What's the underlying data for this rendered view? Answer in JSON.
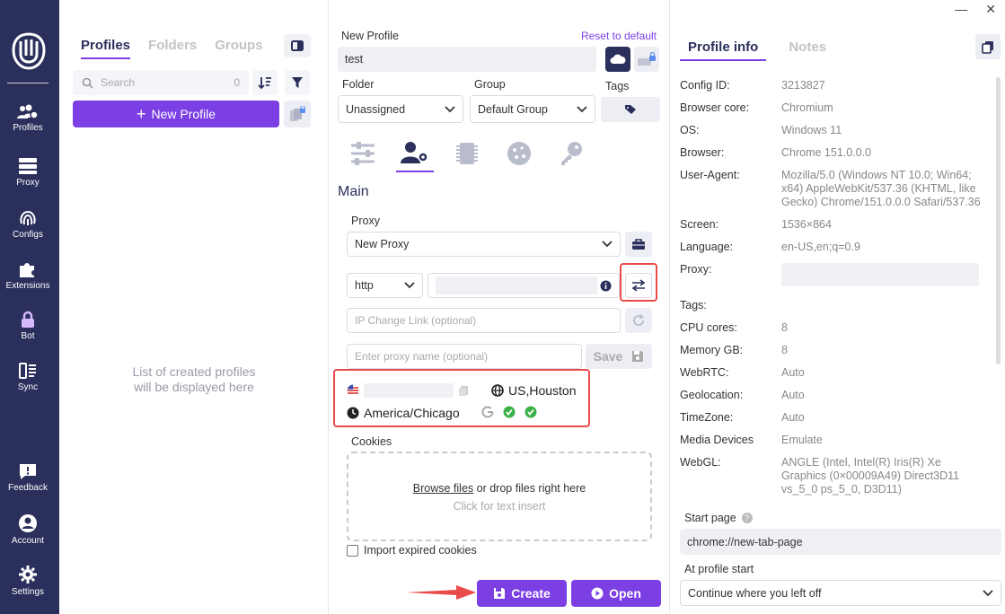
{
  "window": {
    "minimize": "—",
    "close": "✕"
  },
  "nav": {
    "items": [
      {
        "label": "Profiles"
      },
      {
        "label": "Proxy"
      },
      {
        "label": "Configs"
      },
      {
        "label": "Extensions"
      },
      {
        "label": "Bot"
      },
      {
        "label": "Sync"
      },
      {
        "label": "Feedback"
      },
      {
        "label": "Account"
      },
      {
        "label": "Settings"
      }
    ]
  },
  "profiles": {
    "tabs": [
      "Profiles",
      "Folders",
      "Groups"
    ],
    "search_placeholder": "Search",
    "count": "0",
    "new_profile": "New Profile",
    "empty_line1": "List of created profiles",
    "empty_line2": "will be displayed here"
  },
  "form": {
    "name_label": "New Profile",
    "reset": "Reset to default",
    "name_value": "test",
    "folder_label": "Folder",
    "folder_value": "Unassigned",
    "group_label": "Group",
    "group_value": "Default Group",
    "tags_label": "Tags",
    "section": "Main",
    "proxy_label": "Proxy",
    "proxy_value": "New Proxy",
    "protocol": "http",
    "ip_change_placeholder": "IP Change Link (optional)",
    "proxy_name_placeholder": "Enter proxy name (optional)",
    "save": "Save",
    "location": "US,Houston",
    "timezone": "America/Chicago",
    "cookies_label": "Cookies",
    "browse": "Browse files",
    "drop": "or drop files right here",
    "click_insert": "Click for text insert",
    "import_expired": "Import expired cookies",
    "create": "Create",
    "open": "Open"
  },
  "info": {
    "tabs": [
      "Profile info",
      "Notes"
    ],
    "rows": [
      {
        "k": "Config ID:",
        "v": "3213827"
      },
      {
        "k": "Browser core:",
        "v": "Chromium"
      },
      {
        "k": "OS:",
        "v": "Windows 11"
      },
      {
        "k": "Browser:",
        "v": "Chrome 151.0.0.0"
      },
      {
        "k": "User-Agent:",
        "v": "Mozilla/5.0 (Windows NT 10.0; Win64; x64) AppleWebKit/537.36 (KHTML, like Gecko) Chrome/151.0.0.0 Safari/537.36"
      },
      {
        "k": "Screen:",
        "v": "1536×864"
      },
      {
        "k": "Language:",
        "v": "en-US,en;q=0.9"
      },
      {
        "k": "Proxy:",
        "v": ""
      },
      {
        "k": "Tags:",
        "v": ""
      },
      {
        "k": "CPU cores:",
        "v": "8"
      },
      {
        "k": "Memory GB:",
        "v": "8"
      },
      {
        "k": "WebRTC:",
        "v": "Auto"
      },
      {
        "k": "Geolocation:",
        "v": "Auto"
      },
      {
        "k": "TimeZone:",
        "v": "Auto"
      },
      {
        "k": "Media Devices",
        "v": "Emulate"
      },
      {
        "k": "WebGL:",
        "v": "ANGLE (Intel, Intel(R) Iris(R) Xe Graphics (0×00009A49) Direct3D11 vs_5_0 ps_5_0, D3D11)"
      }
    ],
    "start_page_label": "Start page",
    "start_page_value": "chrome://new-tab-page",
    "at_start_label": "At profile start",
    "at_start_value": "Continue where you left off"
  },
  "colors": {
    "accent": "#7b3fe4",
    "nav_bg": "#2a2f5b",
    "highlight": "#e94b4b"
  }
}
